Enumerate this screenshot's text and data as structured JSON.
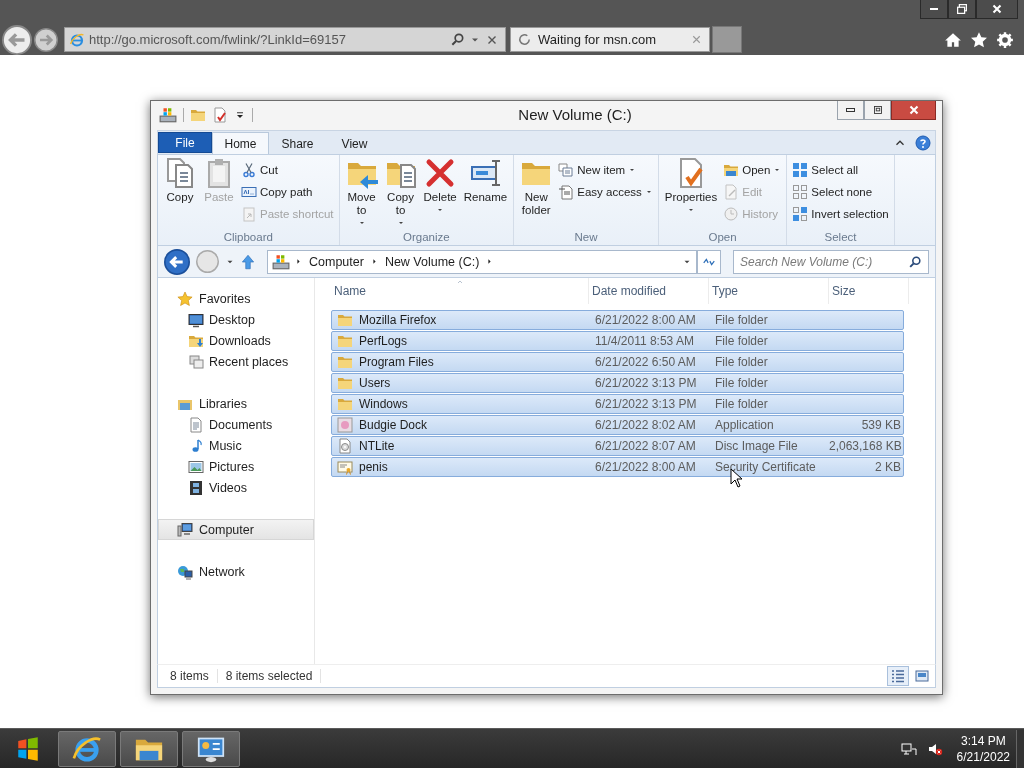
{
  "browser": {
    "address": "http://go.microsoft.com/fwlink/?LinkId=69157",
    "tabs": [
      {
        "label": "Waiting for msn.com",
        "selected": true
      }
    ]
  },
  "explorer": {
    "title": "New Volume (C:)",
    "ribbon_tabs": [
      {
        "label": "File",
        "kind": "menu",
        "selected": false
      },
      {
        "label": "Home",
        "kind": "tab",
        "selected": true
      },
      {
        "label": "Share",
        "kind": "tab",
        "selected": false
      },
      {
        "label": "View",
        "kind": "tab",
        "selected": false
      }
    ],
    "ribbon_groups": [
      {
        "label": "Clipboard",
        "items": [
          {
            "label": "Copy",
            "kind": "large",
            "disabled": false,
            "dropdown": false
          },
          {
            "label": "Paste",
            "kind": "large",
            "disabled": true,
            "dropdown": false
          },
          {
            "label": "Cut",
            "kind": "small",
            "disabled": false,
            "dropdown": false
          },
          {
            "label": "Copy path",
            "kind": "small",
            "disabled": false,
            "dropdown": false
          },
          {
            "label": "Paste shortcut",
            "kind": "small",
            "disabled": true,
            "dropdown": false
          }
        ]
      },
      {
        "label": "Organize",
        "items": [
          {
            "label": "Move to",
            "kind": "large",
            "disabled": false,
            "dropdown": true
          },
          {
            "label": "Copy to",
            "kind": "large",
            "disabled": false,
            "dropdown": true
          },
          {
            "label": "Delete",
            "kind": "large",
            "disabled": false,
            "dropdown": true
          },
          {
            "label": "Rename",
            "kind": "large",
            "disabled": false,
            "dropdown": false
          }
        ]
      },
      {
        "label": "New",
        "items": [
          {
            "label": "New folder",
            "kind": "large",
            "disabled": false,
            "dropdown": false
          },
          {
            "label": "New item",
            "kind": "small",
            "disabled": false,
            "dropdown": true
          },
          {
            "label": "Easy access",
            "kind": "small",
            "disabled": false,
            "dropdown": true
          }
        ]
      },
      {
        "label": "Open",
        "items": [
          {
            "label": "Properties",
            "kind": "large",
            "disabled": false,
            "dropdown": true
          },
          {
            "label": "Open",
            "kind": "small",
            "disabled": false,
            "dropdown": true
          },
          {
            "label": "Edit",
            "kind": "small",
            "disabled": true,
            "dropdown": false
          },
          {
            "label": "History",
            "kind": "small",
            "disabled": true,
            "dropdown": false
          }
        ]
      },
      {
        "label": "Select",
        "items": [
          {
            "label": "Select all",
            "kind": "small",
            "disabled": false,
            "dropdown": false
          },
          {
            "label": "Select none",
            "kind": "small",
            "disabled": false,
            "dropdown": false
          },
          {
            "label": "Invert selection",
            "kind": "small",
            "disabled": false,
            "dropdown": false
          }
        ]
      }
    ],
    "breadcrumbs": [
      "Computer",
      "New Volume (C:)"
    ],
    "search": {
      "placeholder": "Search New Volume (C:)"
    },
    "navigation": [
      {
        "label": "Favorites",
        "selected": false,
        "children": [
          {
            "label": "Desktop",
            "selected": false
          },
          {
            "label": "Downloads",
            "selected": false
          },
          {
            "label": "Recent places",
            "selected": false
          }
        ]
      },
      {
        "label": "Libraries",
        "selected": false,
        "children": [
          {
            "label": "Documents",
            "selected": false
          },
          {
            "label": "Music",
            "selected": false
          },
          {
            "label": "Pictures",
            "selected": false
          },
          {
            "label": "Videos",
            "selected": false
          }
        ]
      },
      {
        "label": "Computer",
        "selected": true
      },
      {
        "label": "Network",
        "selected": false
      }
    ],
    "columns": [
      {
        "label": "Name",
        "sorted": true
      },
      {
        "label": "Date modified",
        "sorted": false
      },
      {
        "label": "Type",
        "sorted": false
      },
      {
        "label": "Size",
        "sorted": false
      }
    ],
    "rows": [
      {
        "name": "Mozilla Firefox",
        "date_modified": "6/21/2022 8:00 AM",
        "type": "File folder",
        "kind": "folder",
        "selected": true
      },
      {
        "name": "PerfLogs",
        "date_modified": "11/4/2011 8:53 AM",
        "type": "File folder",
        "kind": "folder",
        "selected": true
      },
      {
        "name": "Program Files",
        "date_modified": "6/21/2022 6:50 AM",
        "type": "File folder",
        "kind": "folder",
        "selected": true
      },
      {
        "name": "Users",
        "date_modified": "6/21/2022 3:13 PM",
        "type": "File folder",
        "kind": "folder",
        "selected": true
      },
      {
        "name": "Windows",
        "date_modified": "6/21/2022 3:13 PM",
        "type": "File folder",
        "kind": "folder",
        "selected": true
      },
      {
        "name": "Budgie Dock",
        "date_modified": "6/21/2022 8:02 AM",
        "type": "Application",
        "size": "539 KB",
        "kind": "application",
        "selected": true
      },
      {
        "name": "NTLite",
        "date_modified": "6/21/2022 8:07 AM",
        "type": "Disc Image File",
        "size": "2,063,168 KB",
        "kind": "disc_image",
        "selected": true
      },
      {
        "name": "penis",
        "date_modified": "6/21/2022 8:00 AM",
        "type": "Security Certificate",
        "size": "2 KB",
        "kind": "certificate",
        "selected": true
      }
    ],
    "status_bar": {
      "item_count": "8 items",
      "selection": "8 items selected"
    },
    "view_buttons": [
      {
        "selected": true
      },
      {
        "selected": false
      }
    ]
  },
  "taskbar": {
    "time": "3:14 PM",
    "date": "6/21/2022"
  }
}
